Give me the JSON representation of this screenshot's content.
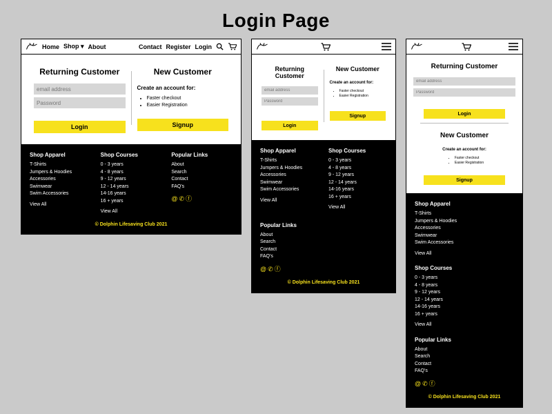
{
  "page_title": "Login Page",
  "nav": {
    "home": "Home",
    "shop": "Shop ▾",
    "about": "About",
    "contact": "Contact",
    "register": "Register",
    "login": "Login"
  },
  "login_panel": {
    "title": "Returning Customer",
    "email_placeholder": "email address",
    "password_placeholder": "Password",
    "button": "Login"
  },
  "signup_panel": {
    "title": "New Customer",
    "create_text": "Create an account for:",
    "bullet1": "Faster checkout",
    "bullet2": "Easier Registration",
    "button": "Signup"
  },
  "footer": {
    "apparel_head": "Shop Apparel",
    "apparel": [
      "T-Shirts",
      "Jumpers & Hoodies",
      "Accessories",
      "Swimwear",
      "Swim Accessories"
    ],
    "courses_head": "Shop Courses",
    "courses": [
      "0 - 3 years",
      "4 - 8 years",
      "9 - 12 years",
      "12 - 14 years",
      "14-16 years",
      "16 + years"
    ],
    "popular_head": "Popular Links",
    "popular": [
      "About",
      "Search",
      "Contact",
      "FAQ's"
    ],
    "viewall": "View All",
    "copyright": "© Dolphin Lifesaving Club 2021"
  }
}
